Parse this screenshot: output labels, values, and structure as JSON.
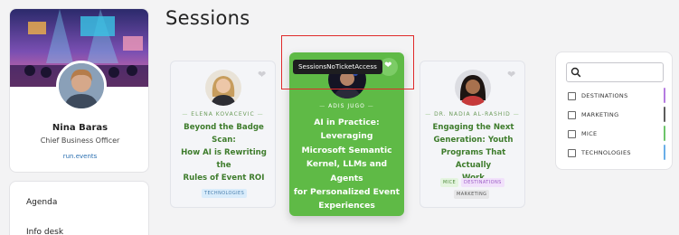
{
  "page": {
    "title": "Sessions"
  },
  "profile": {
    "name": "Nina Baras",
    "role": "Chief Business Officer",
    "link": "run.events"
  },
  "menu": {
    "items": [
      "Agenda",
      "Info desk"
    ]
  },
  "tooltip": "SessionsNoTicketAccess",
  "sessions": [
    {
      "speaker": "ELENA KOVACEVIC",
      "title_lines": [
        "Beyond the Badge Scan:",
        "How AI is Rewriting the",
        "Rules of Event ROI"
      ],
      "tags": [
        "TECHNOLOGIES"
      ],
      "icon": "heart-icon"
    },
    {
      "speaker": "ADIS JUGO",
      "title_lines": [
        "AI in Practice: Leveraging",
        "Microsoft Semantic",
        "Kernel, LLMs and Agents",
        "for Personalized Event",
        "Experiences"
      ],
      "tags": [],
      "icon": "heart-icon"
    },
    {
      "speaker": "DR. NADIA AL-RASHID",
      "title_lines": [
        "Engaging the Next",
        "Generation: Youth",
        "Programs That Actually",
        "Work"
      ],
      "tags": [
        "MICE",
        "DESTINATIONS",
        "MARKETING"
      ],
      "icon": "heart-icon"
    }
  ],
  "filters": {
    "search_placeholder": "",
    "search_icon": "search-icon",
    "items": [
      {
        "label": "DESTINATIONS",
        "color": "#b57be0"
      },
      {
        "label": "MARKETING",
        "color": "#5c5c5c"
      },
      {
        "label": "MICE",
        "color": "#6cc46a"
      },
      {
        "label": "TECHNOLOGIES",
        "color": "#6aaee8"
      }
    ]
  },
  "colors": {
    "accent_green": "#5fba46",
    "tag_technologies": "#d9ecfb",
    "tag_mice": "#e4f4df",
    "tag_destinations": "#f1e1fb",
    "tag_marketing": "#e6e6e8",
    "highlight": "#e02a2a"
  }
}
